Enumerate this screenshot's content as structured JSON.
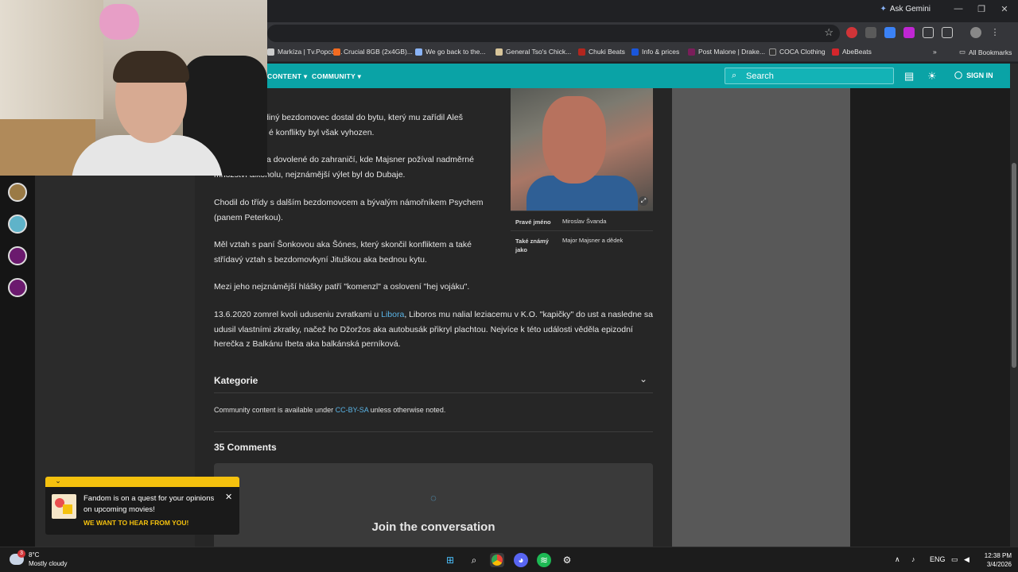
{
  "browser": {
    "ask_gemini": "Ask Gemini",
    "bookmarks": [
      {
        "label": "Markíza | Tv.Popcor...",
        "color": "#cccccc"
      },
      {
        "label": "Crucial 8GB (2x4GB)...",
        "color": "#f26b21"
      },
      {
        "label": "We go back to the...",
        "color": "#8ab4f8"
      },
      {
        "label": "General Tso's Chick...",
        "color": "#d8c59a"
      },
      {
        "label": "Chuki Beats",
        "color": "#b3261e"
      },
      {
        "label": "Info & prices",
        "color": "#1a56db"
      },
      {
        "label": "Post Malone | Drake...",
        "color": "#7a1e5a"
      },
      {
        "label": "COCA Clothing",
        "color": "#333333"
      },
      {
        "label": "AbeBeats",
        "color": "#d4262c"
      }
    ],
    "all_bookmarks": "All Bookmarks"
  },
  "nav": {
    "content": "CONTENT",
    "community": "COMMUNITY",
    "search_placeholder": "Search",
    "sign_in": "SIGN IN"
  },
  "article": {
    "p1_a": "ko jediný bezdomovec dostal do bytu, který mu zařídil Aleš",
    "p1_b": "é konflikty byl však vyhozen.",
    "p2_a": "a dovolené do zahraničí, kde Majsner požíval nadměrné",
    "p2_b": "množství alkoholu, nejznámější výlet byl do Dubaje.",
    "p3": "Chodil do třídy s dalším bezdomovcem a bývalým námořníkem Psychem (panem Peterkou).",
    "p4": "Měl vztah s paní Šonkovou aka Šónes, který skončil konfliktem a také střídavý vztah s bezdomovkyní Jituškou aka bednou kytu.",
    "p5": "Mezi jeho nejznámější hlášky patří \"komenzl\" a oslovení \"hej vojáku\".",
    "p6_pre": "13.6.2020 zomrel kvoli uduseniu zvratkami u ",
    "p6_link": "Libora",
    "p6_post": ", Liboros mu nalial leziacemu v K.O. \"kapičky\" do ust a nasledne sa udusil vlastními zkratky, načež ho Džoržos aka autobusák přikryl plachtou. Nejvíce k této události věděla epizodní herečka z Balkánu Ibeta aka balkánská perníková."
  },
  "infobox": {
    "real_name_label": "Pravé jméno",
    "real_name_value": "Miroslav Švanda",
    "aka_label": "Také známý jako",
    "aka_value": "Major Majsner a dědek"
  },
  "categories": "Kategorie",
  "license": {
    "pre": "Community content is available under ",
    "link": "CC-BY-SA",
    "post": " unless otherwise noted."
  },
  "comments": {
    "count_label": "35 Comments",
    "join": "Join the conversation"
  },
  "toast": {
    "text": "Fandom is on a quest for your opinions on upcoming movies!",
    "cta": "WE WANT TO HEAR FROM YOU!"
  },
  "taskbar": {
    "weather_temp": "8°C",
    "weather_desc": "Mostly cloudy",
    "weather_badge": "3",
    "lang": "ENG",
    "time": "12:38 PM",
    "date": "3/4/2026"
  }
}
